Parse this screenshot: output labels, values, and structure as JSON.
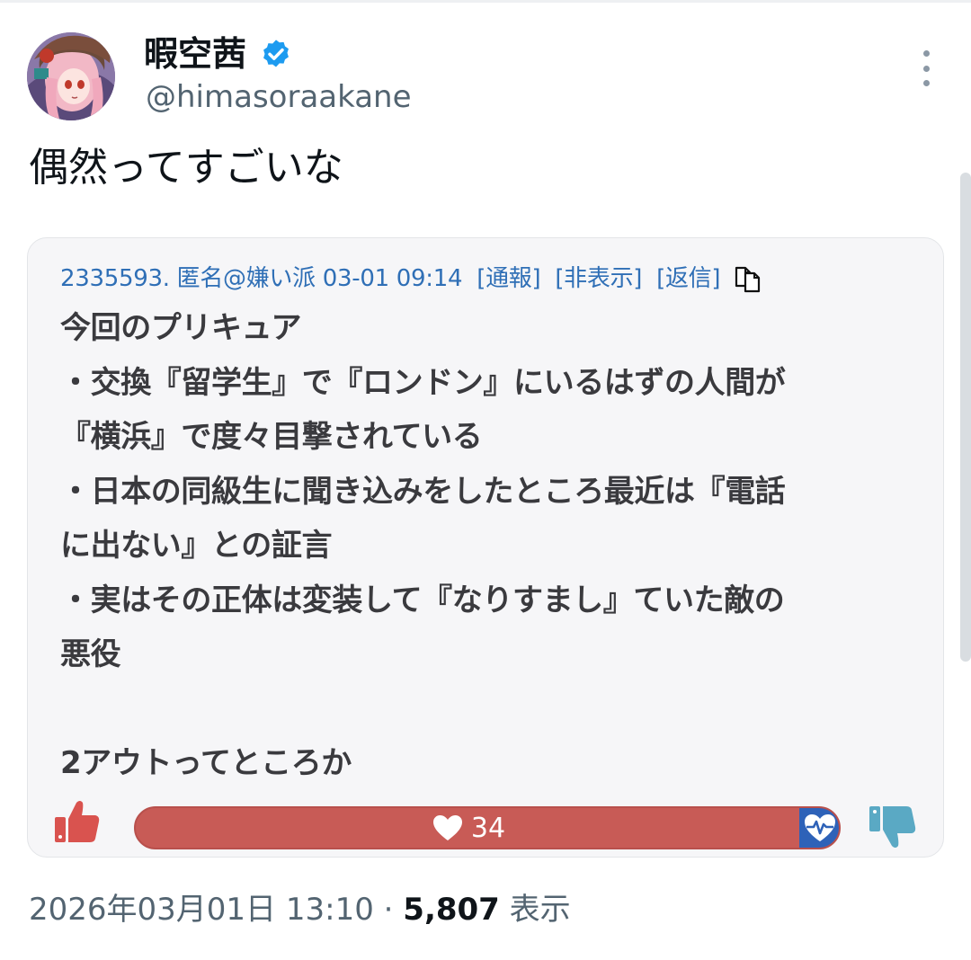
{
  "author": {
    "display_name": "暇空茜",
    "handle": "@himasoraakane",
    "verified": true
  },
  "tweet": {
    "text": "偶然ってすごいな"
  },
  "embedded_post": {
    "header_meta": "2335593. 匿名@嫌い派 03-01 09:14",
    "actions": [
      "[通報]",
      "[非表示]",
      "[返信]"
    ],
    "lines": [
      "今回のプリキュア",
      "・交換『留学生』で『ロンドン』にいるはずの人間が",
      "『横浜』で度々目撃されている",
      "・日本の同級生に聞き込みをしたところ最近は『電話",
      "に出ない』との証言",
      "・実はその正体は変装して『なりすまし』ていた敵の",
      "悪役",
      "",
      "2アウトってところか"
    ],
    "vote_count": "34"
  },
  "meta": {
    "timestamp": "2026年03月01日 13:10",
    "separator": "·",
    "views": "5,807",
    "views_label": "表示"
  },
  "colors": {
    "link_blue": "#2f6fb6",
    "vote_bar_red": "#c85b56",
    "vote_end_blue": "#2e62b8",
    "verified_blue": "#1d9bf0"
  }
}
